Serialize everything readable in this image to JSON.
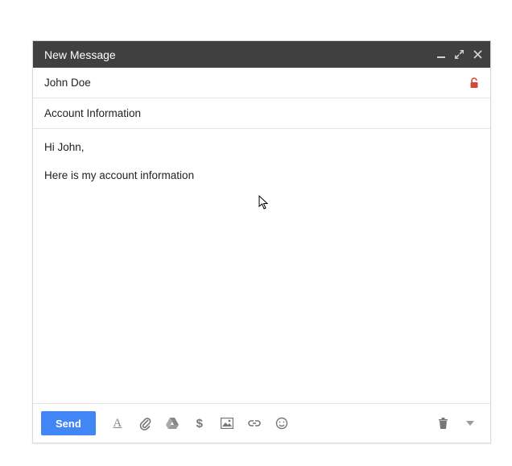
{
  "header": {
    "title": "New Message"
  },
  "fields": {
    "to": "John Doe",
    "subject": "Account Information"
  },
  "body": {
    "line1": "Hi John,",
    "line2": "Here is my account information"
  },
  "toolbar": {
    "send_label": "Send"
  }
}
